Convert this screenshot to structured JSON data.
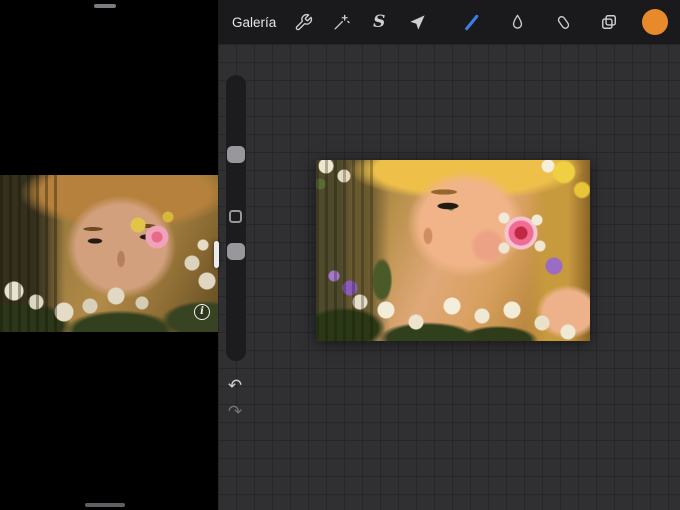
{
  "reference_app": {
    "photo_alt": "Reference photo: close-up of a woman's eyes and blonde hair with a flower garland",
    "info_button_glyph": "i"
  },
  "split_view": {
    "divider_handle": "drag-to-resize",
    "left_window_handle": "drag-handle",
    "home_indicator": "home"
  },
  "procreate": {
    "topbar": {
      "gallery_label": "Galería",
      "left_tools": [
        {
          "name": "actions",
          "icon": "wrench-icon"
        },
        {
          "name": "adjustments",
          "icon": "magic-wand-icon"
        },
        {
          "name": "selection",
          "icon": "selection-s-icon",
          "glyph": "S"
        },
        {
          "name": "transform",
          "icon": "transform-arrow-icon"
        }
      ],
      "right_tools": [
        {
          "name": "paint",
          "icon": "brush-icon",
          "active": true
        },
        {
          "name": "smudge",
          "icon": "smudge-icon",
          "active": false
        },
        {
          "name": "erase",
          "icon": "eraser-icon",
          "active": false
        },
        {
          "name": "layers",
          "icon": "layers-icon",
          "active": false
        },
        {
          "name": "color",
          "icon": "color-swatch",
          "value": "#e8892b"
        }
      ],
      "active_tool_color": "#3d7de0"
    },
    "sidebar": {
      "undo_glyph": "↶",
      "redo_glyph": "↷"
    },
    "canvas": {
      "artwork_alt": "Painted study of the reference photo: woman with blonde hair, green eye, flower garland with red, purple, white and yellow flowers"
    }
  }
}
